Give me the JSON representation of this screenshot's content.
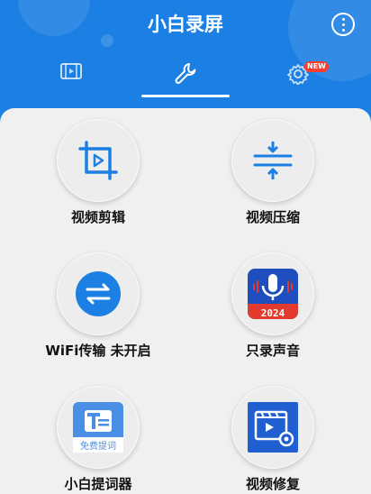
{
  "app": {
    "title": "小白录屏"
  },
  "tabs": {
    "settings_badge": "NEW"
  },
  "tools": [
    {
      "label": "视频剪辑"
    },
    {
      "label": "视频压缩"
    },
    {
      "label": "WiFi传输 未开启"
    },
    {
      "label": "只录声音",
      "year": "2024"
    },
    {
      "label": "小白提词器",
      "sub": "免费提词"
    },
    {
      "label": "视频修复"
    }
  ],
  "colors": {
    "accent": "#1b7fe3",
    "mic_bg": "#1f4fbf",
    "mic_bottom": "#e23a2c"
  }
}
